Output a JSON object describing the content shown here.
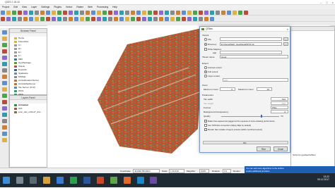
{
  "window": {
    "title": "QGIS 2.18.16"
  },
  "menu": [
    "Project",
    "Edit",
    "View",
    "Layer",
    "Settings",
    "Plugins",
    "Vector",
    "Raster",
    "Web",
    "Processing",
    "Help"
  ],
  "browser": {
    "title": "Browser Panel",
    "items": [
      "Home",
      "Favourites",
      "C:/",
      "D:/",
      "E:/",
      "F:/",
      "DB2",
      "GeoPackage",
      "Oracle",
      "PostGIS",
      "SpatiaLite",
      "MSSQL",
      "ArcGisFeatureServer",
      "ArcGisMapServer",
      "Tile Server (XYZ)",
      "WCS",
      "WFS",
      "WMS"
    ]
  },
  "layers": {
    "title": "Layers Panel",
    "items": [
      "tetraedad",
      "AOI",
      "proc_dsc_ortho17_dsc..."
    ]
  },
  "dialog": {
    "title": "QTiles",
    "output_label": "Output",
    "file_label": "File",
    "directory_label": "Directory",
    "directory_value": "E:/Users/Dash_Geo/Desa/NiTQ.gtt",
    "mbtiles_label": "Write Mapbox",
    "app_label": "app",
    "tileset_label": "Tileset name",
    "tileset_value": "Gpod",
    "extent_label": "Extent",
    "canvas_extent": "Canvas extent",
    "full_extent": "Full extent",
    "layer_extent": "Layer extent",
    "layer_value": "AOI",
    "zoom_label": "Zoom",
    "min_zoom_label": "Minimum zoom",
    "min_zoom_value": "0",
    "max_zoom_label": "Maximum zoom",
    "max_zoom_value": "16",
    "params_label": "Parameters",
    "tile_width_label": "Tile width",
    "tile_width_value": "512",
    "tile_height_label": "Tile height",
    "tile_height_value": "512",
    "format_label": "Format",
    "format_value": "PNG",
    "transparency_label": "Background transparency",
    "transparency_value": "0",
    "quality_label": "Quality",
    "quality_value": "70",
    "antialias_label": "Make lines appear less jagged at the expense of some drawing performance",
    "tms_label": "Use TMS tiles convention (Slippy Map by default)",
    "outside_label": "Render tiles outside of layers extents (within combined extent)",
    "progress_value": "0%",
    "progress": 0,
    "run_label": "Run",
    "close_label": "Close"
  },
  "status": {
    "coordinate_label": "Coordinate",
    "coordinate_value": "401990,5519424",
    "scale_label": "Scale",
    "scale_value": "1:19,519",
    "magnifier_label": "Magnifier",
    "magnifier_value": "100%",
    "rotation_label": "Rotation",
    "rotation_value": "0.0",
    "render_label": "Render",
    "epsg": "EPSG:25832 (OTF)"
  },
  "right_panel": {
    "row": "Script (in geobjects/files)"
  },
  "notification": {
    "line1": "You can add more algorithms to the toolbox",
    "line2": "enable additional providers"
  },
  "taskbar": {
    "time": "13:22",
    "date": "05.12.2017"
  }
}
